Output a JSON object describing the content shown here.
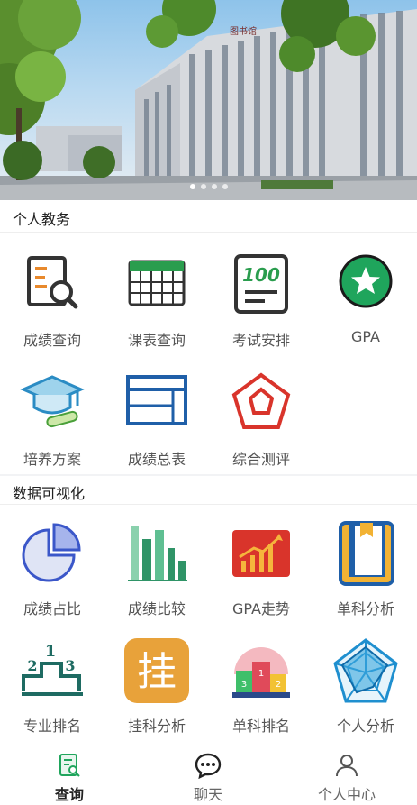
{
  "banner": {
    "building_sign": "图书馆",
    "slides": 4,
    "active_slide": 1
  },
  "section_personal": {
    "title": "个人教务",
    "items": [
      {
        "label": "成绩查询",
        "icon": "report-search-icon"
      },
      {
        "label": "课表查询",
        "icon": "timetable-icon"
      },
      {
        "label": "考试安排",
        "icon": "exam-100-icon"
      },
      {
        "label": "GPA",
        "icon": "star-badge-icon"
      },
      {
        "label": "培养方案",
        "icon": "graduation-cap-icon"
      },
      {
        "label": "成绩总表",
        "icon": "grade-table-icon"
      },
      {
        "label": "综合测评",
        "icon": "pentagon-icon"
      }
    ]
  },
  "section_visual": {
    "title": "数据可视化",
    "items": [
      {
        "label": "成绩占比",
        "icon": "pie-chart-icon"
      },
      {
        "label": "成绩比较",
        "icon": "bar-chart-icon"
      },
      {
        "label": "GPA走势",
        "icon": "trend-chart-icon"
      },
      {
        "label": "单科分析",
        "icon": "book-icon"
      },
      {
        "label": "专业排名",
        "icon": "podium-icon"
      },
      {
        "label": "挂科分析",
        "icon": "gua-character-icon"
      },
      {
        "label": "单科排名",
        "icon": "podium-color-icon"
      },
      {
        "label": "个人分析",
        "icon": "radar-chart-icon"
      }
    ],
    "gua_char": "挂",
    "exam_score": "100",
    "podium_numbers": [
      "1",
      "2",
      "3"
    ]
  },
  "tabbar": {
    "tabs": [
      {
        "label": "查询",
        "icon": "query-icon",
        "active": true
      },
      {
        "label": "聊天",
        "icon": "chat-icon",
        "active": false
      },
      {
        "label": "个人中心",
        "icon": "person-icon",
        "active": false
      }
    ]
  },
  "colors": {
    "green": "#1fa55c",
    "blue": "#2b6cb0",
    "orange": "#e8a23a",
    "red": "#d9342b",
    "teal": "#2a7d74"
  }
}
